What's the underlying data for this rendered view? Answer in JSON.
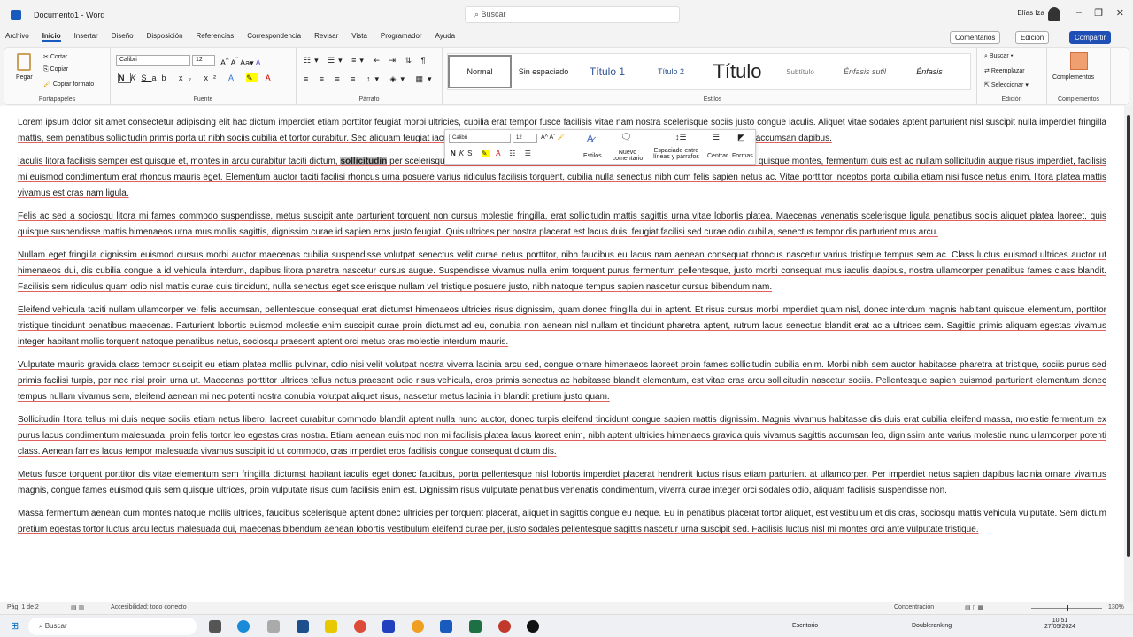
{
  "title": "Documento1 - Word",
  "search_placeholder": "Buscar",
  "user": "Elías Iza",
  "tabs": [
    "Archivo",
    "Inicio",
    "Insertar",
    "Diseño",
    "Disposición",
    "Referencias",
    "Correspondencia",
    "Revisar",
    "Vista",
    "Programador",
    "Ayuda"
  ],
  "top_buttons": {
    "comments": "Comentarios",
    "editing": "Edición",
    "share": "Compartir"
  },
  "clipboard": {
    "paste": "Pegar",
    "cut": "Cortar",
    "copy": "Copiar",
    "format": "Copiar formato",
    "label": "Portapapeles"
  },
  "font": {
    "name": "Calibri",
    "size": "12",
    "label": "Fuente"
  },
  "paragraph_label": "Párrafo",
  "styles": {
    "items": [
      "Normal",
      "Sin espaciado",
      "Título 1",
      "Título 2",
      "Título",
      "Subtítulo",
      "Énfasis sutil",
      "Énfasis"
    ],
    "label": "Estilos"
  },
  "editing": {
    "find": "Buscar",
    "replace": "Reemplazar",
    "select": "Seleccionar",
    "label": "Edición"
  },
  "addins": {
    "button": "Complementos",
    "label": "Complementos"
  },
  "mini_toolbar": {
    "font": "Calibri",
    "size": "12",
    "styles": "Estilos",
    "comment": "Nuevo comentario",
    "spacing": "Espaciado entre líneas y párrafos",
    "center": "Centrar",
    "buscar": "Formas"
  },
  "paragraphs": [
    "Lorem ipsum dolor sit amet consectetur adipiscing elit hac dictum imperdiet etiam porttitor feugiat morbi ultricies, cubilia erat tempor fusce facilisis vitae nam nostra scelerisque sociis justo congue iaculis. Aliquet vitae sodales aptent parturient nisl suscipit nulla imperdiet fringilla mattis, sem penatibus sollicitudin primis porta ut nibh sociis cubilia et tortor curabitur. Sed aliquam feugiat iaculis mattis nunc platea pharetra dictum cum, fermentum vivamus cubilia arcu ut accumsan dapibus.",
    "Iaculis litora facilisis semper est quisque et, montes in arcu curabitur taciti dictum, |sollicitudin| per scelerisque natoque sed. Aptent cubilia sociis molestie commodo id ullamcorper interdum quisque montes, fermentum duis est ac nullam sollicitudin augue risus imperdiet, facilisis mi euismod condimentum erat rhoncus mauris eget. Elementum auctor taciti facilisi rhoncus urna posuere varius ridiculus facilisis torquent, cubilia nulla senectus nibh cum felis sapien netus ac. Vitae porttitor inceptos porta cubilia etiam nisi fusce netus enim, litora platea mattis vivamus est cras nam ligula.",
    "Felis ac sed a sociosqu litora mi fames commodo suspendisse, metus suscipit ante parturient torquent non cursus molestie fringilla, erat sollicitudin mattis sagittis urna vitae lobortis platea. Maecenas venenatis scelerisque ligula penatibus sociis aliquet platea laoreet, quis quisque suspendisse mattis himenaeos urna mus mollis sagittis, dignissim curae id sapien eros justo feugiat. Quis ultrices per nostra placerat est lacus duis, feugiat facilisi sed curae odio cubilia, senectus tempor dis parturient mus arcu.",
    "Nullam eget fringilla dignissim euismod cursus morbi auctor maecenas cubilia suspendisse volutpat senectus velit curae netus porttitor, nibh faucibus eu lacus nam aenean consequat rhoncus nascetur varius tristique tempus sem ac. Class luctus euismod ultrices auctor ut himenaeos dui, dis cubilia congue a id vehicula interdum, dapibus litora pharetra nascetur cursus augue. Suspendisse vivamus nulla enim torquent purus fermentum pellentesque, justo morbi consequat mus iaculis dapibus, nostra ullamcorper penatibus fames class blandit. Facilisis sem ridiculus quam odio nisl mattis curae quis tincidunt, nulla senectus eget scelerisque nullam vel tristique posuere justo, nibh natoque tempus sapien nascetur cursus bibendum nam.",
    "Eleifend vehicula taciti nullam ullamcorper vel felis accumsan, pellentesque consequat erat dictumst himenaeos ultricies risus dignissim, quam donec fringilla dui in aptent. Et risus cursus morbi imperdiet quam nisl, donec interdum magnis habitant quisque elementum, porttitor tristique tincidunt penatibus maecenas. Parturient lobortis euismod molestie enim suscipit curae proin dictumst ad eu, conubia non aenean nisl nullam et tincidunt pharetra aptent, rutrum lacus senectus blandit erat ac a ultrices sem. Sagittis primis aliquam egestas vivamus integer habitant mollis torquent natoque penatibus netus, sociosqu praesent aptent orci metus cras molestie interdum mauris.",
    "Vulputate mauris gravida class tempor suscipit eu etiam platea mollis pulvinar, odio nisi velit volutpat nostra viverra lacinia arcu sed, congue ornare himenaeos laoreet proin fames sollicitudin cubilia enim. Morbi nibh sem auctor habitasse pharetra at tristique, sociis purus sed primis facilisi turpis, per nec nisl proin urna ut. Maecenas porttitor ultrices tellus netus praesent odio risus vehicula, eros primis senectus ac habitasse blandit elementum, est vitae cras arcu sollicitudin nascetur sociis. Pellentesque sapien euismod parturient elementum donec tempus nullam vivamus sem, eleifend aenean mi nec potenti nostra conubia volutpat aliquet risus, nascetur metus lacinia in blandit pretium justo quam.",
    "Sollicitudin litora tellus mi duis neque sociis etiam netus libero, laoreet curabitur commodo blandit aptent nulla nunc auctor, donec turpis eleifend tincidunt congue sapien mattis dignissim. Magnis vivamus habitasse dis duis erat cubilia eleifend massa, molestie fermentum ex purus lacus condimentum malesuada, proin felis tortor leo egestas cras nostra. Etiam aenean euismod non mi facilisis platea lacus laoreet enim, nibh aptent ultricies himenaeos gravida quis vivamus sagittis accumsan leo, dignissim ante varius molestie nunc ullamcorper potenti class. Aenean fames lacus tempor malesuada vivamus suscipit id ut commodo, cras imperdiet eros facilisis congue consequat dictum dis.",
    "Metus fusce torquent porttitor dis vitae elementum sem fringilla dictumst habitant iaculis eget donec faucibus, porta pellentesque nisl lobortis imperdiet placerat hendrerit luctus risus etiam parturient at ullamcorper. Per imperdiet netus sapien dapibus lacinia ornare vivamus magnis, congue fames euismod quis sem quisque ultrices, proin vulputate risus cum facilisis enim est. Dignissim risus vulputate penatibus venenatis condimentum, viverra curae integer orci sodales odio, aliquam facilisis suspendisse non.",
    "Massa fermentum aenean cum montes natoque mollis ultrices, faucibus scelerisque aptent donec ultricies per torquent placerat, aliquet in sagittis congue eu neque. Eu in penatibus placerat tortor aliquet, est vestibulum et dis cras, sociosqu mattis vehicula vulputate. Sem dictum pretium egestas tortor luctus arcu lectus malesuada dui, maecenas bibendum aenean lobortis vestibulum eleifend curae per, justo sodales pellentesque sagittis nascetur urna suscipit sed. Facilisis luctus nisl mi montes orci ante vulputate tristique."
  ],
  "status": {
    "page": "Pág. 1 de 2",
    "words": "Accesibilidad: todo correcto",
    "focus": "Concentración",
    "zoom": "130%"
  },
  "taskbar": {
    "search": "Buscar",
    "weather": "Escritorio",
    "app": "Doubleranking",
    "time": "10:51",
    "date": "27/05/2024"
  },
  "colors": {
    "accent": "#185abd",
    "spell": "#e06060"
  }
}
